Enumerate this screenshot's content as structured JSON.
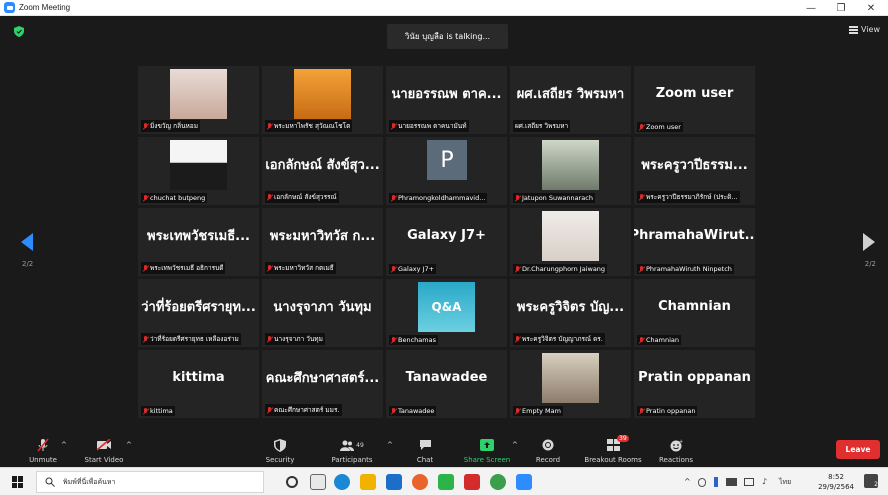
{
  "window": {
    "title": "Zoom Meeting",
    "minimize": "—",
    "restore": "❐",
    "close": "✕"
  },
  "top": {
    "talking": "วินัย บุญลือ is talking...",
    "view_label": "View"
  },
  "pager": {
    "left": "2/2",
    "right": "2/2"
  },
  "tiles": [
    {
      "id": "t1",
      "type": "photo",
      "photo": "woman",
      "caption": "มิ่งขวัญ กลิ่นหอม"
    },
    {
      "id": "t2",
      "type": "photo",
      "photo": "monk",
      "caption": "พระมหาไพรัช สุวัณณโชโต"
    },
    {
      "id": "t3",
      "type": "name",
      "name": "นายอรรณพ ตาค...",
      "caption": "นายอรรณพ ตาคนามันท์"
    },
    {
      "id": "t4",
      "type": "name",
      "name": "ผศ.เสถียร วิพรมหา",
      "caption": "ผศ.เสถียร วิพรมหา",
      "nomic": true
    },
    {
      "id": "t5",
      "type": "name",
      "name": "Zoom user",
      "caption": "Zoom user"
    },
    {
      "id": "t6",
      "type": "photo",
      "photo": "man",
      "caption": "chuchat butpeng"
    },
    {
      "id": "t7",
      "type": "name",
      "name": "เอกลักษณ์ สังข์สุว...",
      "caption": "เอกลักษณ์ สังข์สุวรรณ์"
    },
    {
      "id": "t8",
      "type": "avatar",
      "letter": "P",
      "caption": "Phramongkoldhammavid..."
    },
    {
      "id": "t9",
      "type": "photo",
      "photo": "office",
      "caption": "Jatupon Suwannarach"
    },
    {
      "id": "t10",
      "type": "name",
      "name": "พระครูวาปีธรรม...",
      "caption": "พระครูวาปีธรรมาภิรักษ์ (ประดิ..."
    },
    {
      "id": "t11",
      "type": "name",
      "name": "พระเทพวัชรเมธี...",
      "caption": "พระเทพวัชรเมธี อธิการบดี"
    },
    {
      "id": "t12",
      "type": "name",
      "name": "พระมหาวิทวัส ก...",
      "caption": "พระมหาวิทวัส กตเมธี"
    },
    {
      "id": "t13",
      "type": "name",
      "name": "Galaxy J7+",
      "caption": "Galaxy J7+"
    },
    {
      "id": "t14",
      "type": "photo",
      "photo": "nurse",
      "caption": "Dr.Charungphorn Jaiwang"
    },
    {
      "id": "t15",
      "type": "name",
      "name": "PhramahaWirut...",
      "caption": "PhramahaWiruth Ninpetch"
    },
    {
      "id": "t16",
      "type": "name",
      "name": "ว่าที่ร้อยตรีศรายุท...",
      "caption": "ว่าที่ร้อยตรีศรายุทธ เหลืองอร่าม"
    },
    {
      "id": "t17",
      "type": "name",
      "name": "นางรุจาภา วันทุม",
      "caption": "นางรุจาภา วันทุม"
    },
    {
      "id": "t18",
      "type": "photo",
      "photo": "qa",
      "photo_text": "Q&A",
      "caption": "Benchamas"
    },
    {
      "id": "t19",
      "type": "name",
      "name": "พระครูวิจิตร บัญ...",
      "caption": "พระครูวิจิตร บัญญาภรณ์ ดร."
    },
    {
      "id": "t20",
      "type": "name",
      "name": "Chamnian",
      "caption": "Chamnian"
    },
    {
      "id": "t21",
      "type": "name",
      "name": "kittima",
      "caption": "kittima"
    },
    {
      "id": "t22",
      "type": "name",
      "name": "คณะศึกษาศาสตร์...",
      "caption": "คณะศึกษาศาสตร์ มมร."
    },
    {
      "id": "t23",
      "type": "name",
      "name": "Tanawadee",
      "caption": "Tanawadee"
    },
    {
      "id": "t24",
      "type": "photo",
      "photo": "meet",
      "caption": "Empty Mam"
    },
    {
      "id": "t25",
      "type": "name",
      "name": "Pratin oppanan",
      "caption": "Pratin oppanan"
    }
  ],
  "toolbar": {
    "unmute": "Unmute",
    "start_video": "Start Video",
    "security": "Security",
    "participants": "Participants",
    "participants_count": "49",
    "chat": "Chat",
    "share_screen": "Share Screen",
    "record": "Record",
    "breakout_rooms": "Breakout Rooms",
    "breakout_badge": "39",
    "reactions": "Reactions",
    "leave": "Leave"
  },
  "taskbar": {
    "search_placeholder": "พิมพ์ที่นี่เพื่อค้นหา",
    "time": "8:52",
    "date": "29/9/2564",
    "lang": "ไทย",
    "notif_count": "2"
  },
  "colors": {
    "accent": "#2d8cff",
    "mic_muted": "#e02828",
    "leave": "#e02f2f",
    "share": "#2dd26b"
  }
}
